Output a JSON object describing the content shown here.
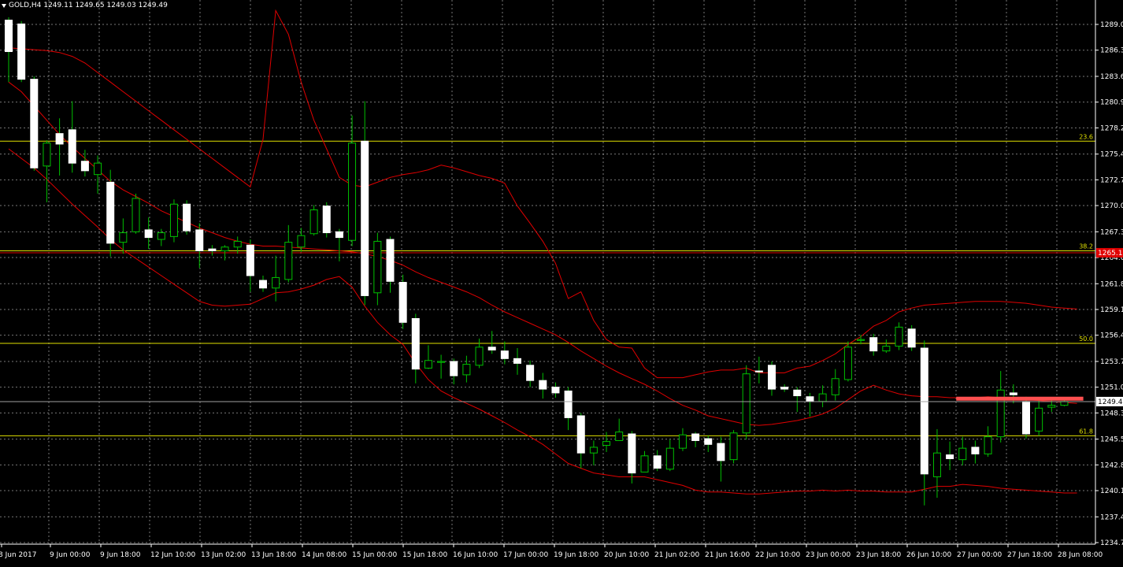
{
  "header": {
    "symbol": "GOLD,H4",
    "ohlc": "1249.11 1249.65 1249.03 1249.49"
  },
  "colors": {
    "background": "#000000",
    "grid": "#c8c8c8",
    "bull_body": "#000000",
    "bear_body": "#ffffff",
    "wick": "#00c000",
    "bollinger": "#e00000",
    "fib": "#e0e000",
    "resistance": "#ff5050",
    "price_line": "#a0a0a0"
  },
  "price_axis_labels": [
    "1289.05",
    "1286.35",
    "1283.60",
    "1280.90",
    "1278.20",
    "1275.45",
    "1272.75",
    "1270.05",
    "1267.30",
    "1264.60",
    "1261.85",
    "1259.15",
    "1256.45",
    "1253.70",
    "1251.00",
    "1248.30",
    "1245.55",
    "1242.85",
    "1240.15",
    "1237.40",
    "1234.70"
  ],
  "time_axis_labels": [
    "8 Jun 2017",
    "9 Jun 00:00",
    "9 Jun 18:00",
    "12 Jun 10:00",
    "13 Jun 02:00",
    "13 Jun 18:00",
    "14 Jun 08:00",
    "15 Jun 00:00",
    "15 Jun 18:00",
    "16 Jun 10:00",
    "17 Jun 00:00",
    "19 Jun 18:00",
    "20 Jun 10:00",
    "21 Jun 02:00",
    "21 Jun 16:00",
    "22 Jun 10:00",
    "23 Jun 00:00",
    "23 Jun 18:00",
    "26 Jun 10:00",
    "27 Jun 00:00",
    "27 Jun 18:00",
    "28 Jun 08:00"
  ],
  "current_price": {
    "label": "1249.49",
    "value": 1249.49
  },
  "red_marker": {
    "label": "1265.1",
    "value": 1265.1
  },
  "fib_levels": [
    {
      "label": "23.6",
      "value": 1276.8
    },
    {
      "label": "38.2",
      "value": 1265.3
    },
    {
      "label": "50.0",
      "value": 1255.6
    },
    {
      "label": "61.8",
      "value": 1245.9
    }
  ],
  "resistance_line": {
    "value": 1249.8,
    "from_index": 75,
    "to_index": 84
  },
  "chart_data": {
    "type": "candlestick",
    "instrument": "GOLD",
    "timeframe": "H4",
    "ylim": [
      1234.7,
      1290.5
    ],
    "candles": [
      [
        1289.5,
        1286.2,
        1289.8,
        1283.0
      ],
      [
        1289.1,
        1283.3,
        1289.4,
        1283.0
      ],
      [
        1283.3,
        1274.0,
        1283.6,
        1273.7
      ],
      [
        1274.2,
        1276.6,
        1276.9,
        1270.4
      ],
      [
        1277.6,
        1276.5,
        1279.2,
        1273.2
      ],
      [
        1278.0,
        1274.5,
        1281.0,
        1273.5
      ],
      [
        1274.7,
        1273.7,
        1275.9,
        1273.1
      ],
      [
        1273.3,
        1274.5,
        1275.3,
        1271.3
      ],
      [
        1272.5,
        1266.1,
        1273.8,
        1264.7
      ],
      [
        1266.2,
        1267.2,
        1268.7,
        1265.0
      ],
      [
        1267.3,
        1270.8,
        1271.3,
        1267.1
      ],
      [
        1267.5,
        1266.7,
        1268.8,
        1265.5
      ],
      [
        1266.5,
        1267.2,
        1267.6,
        1265.8
      ],
      [
        1266.8,
        1270.2,
        1270.7,
        1266.2
      ],
      [
        1270.2,
        1267.4,
        1270.6,
        1267.0
      ],
      [
        1267.5,
        1265.3,
        1268.2,
        1263.5
      ],
      [
        1265.5,
        1265.3,
        1265.9,
        1264.8
      ],
      [
        1265.3,
        1265.7,
        1265.9,
        1264.3
      ],
      [
        1265.7,
        1266.3,
        1266.8,
        1265.0
      ],
      [
        1265.9,
        1262.7,
        1266.5,
        1261.0
      ],
      [
        1262.2,
        1261.4,
        1262.7,
        1261.0
      ],
      [
        1261.4,
        1262.5,
        1264.8,
        1260.0
      ],
      [
        1262.3,
        1266.2,
        1268.0,
        1262.0
      ],
      [
        1265.7,
        1266.9,
        1267.7,
        1265.2
      ],
      [
        1267.1,
        1269.6,
        1270.1,
        1266.9
      ],
      [
        1270.0,
        1267.2,
        1270.4,
        1266.7
      ],
      [
        1267.3,
        1266.7,
        1267.6,
        1264.2
      ],
      [
        1266.4,
        1276.6,
        1279.5,
        1265.8
      ],
      [
        1276.8,
        1260.6,
        1281.0,
        1259.6
      ],
      [
        1260.9,
        1266.3,
        1267.2,
        1259.6
      ],
      [
        1266.5,
        1262.1,
        1266.8,
        1260.9
      ],
      [
        1262.0,
        1257.8,
        1262.8,
        1257.1
      ],
      [
        1258.2,
        1252.9,
        1258.7,
        1251.4
      ],
      [
        1253.0,
        1253.8,
        1255.4,
        1252.9
      ],
      [
        1253.6,
        1253.7,
        1254.4,
        1251.9
      ],
      [
        1253.7,
        1252.2,
        1254.0,
        1251.3
      ],
      [
        1252.3,
        1253.4,
        1254.3,
        1251.5
      ],
      [
        1253.3,
        1255.2,
        1256.1,
        1253.0
      ],
      [
        1255.2,
        1254.9,
        1256.9,
        1254.5
      ],
      [
        1254.8,
        1254.0,
        1255.8,
        1253.4
      ],
      [
        1254.0,
        1253.5,
        1255.1,
        1252.3
      ],
      [
        1253.3,
        1251.7,
        1253.8,
        1251.0
      ],
      [
        1251.7,
        1250.8,
        1252.5,
        1249.8
      ],
      [
        1251.0,
        1250.4,
        1251.5,
        1249.9
      ],
      [
        1250.6,
        1247.8,
        1251.0,
        1246.5
      ],
      [
        1248.0,
        1244.1,
        1248.3,
        1242.5
      ],
      [
        1244.1,
        1244.7,
        1245.4,
        1242.8
      ],
      [
        1244.9,
        1245.3,
        1246.3,
        1244.2
      ],
      [
        1245.4,
        1246.3,
        1247.7,
        1245.6
      ],
      [
        1246.1,
        1242.0,
        1246.4,
        1240.9
      ],
      [
        1242.1,
        1243.8,
        1244.3,
        1242.9
      ],
      [
        1243.8,
        1242.5,
        1244.4,
        1242.2
      ],
      [
        1242.4,
        1244.6,
        1245.5,
        1242.2
      ],
      [
        1244.6,
        1246.0,
        1246.7,
        1244.3
      ],
      [
        1246.1,
        1245.4,
        1246.3,
        1244.7
      ],
      [
        1245.6,
        1245.0,
        1245.9,
        1244.2
      ],
      [
        1245.1,
        1243.3,
        1245.8,
        1241.1
      ],
      [
        1243.4,
        1246.2,
        1246.5,
        1243.0
      ],
      [
        1246.2,
        1252.4,
        1253.3,
        1245.5
      ],
      [
        1252.7,
        1252.6,
        1254.2,
        1251.4
      ],
      [
        1253.3,
        1250.8,
        1253.7,
        1250.1
      ],
      [
        1251.0,
        1250.8,
        1251.3,
        1250.5
      ],
      [
        1250.7,
        1250.1,
        1251.0,
        1248.4
      ],
      [
        1250.0,
        1249.5,
        1250.4,
        1247.9
      ],
      [
        1249.5,
        1250.3,
        1251.2,
        1248.9
      ],
      [
        1250.2,
        1251.9,
        1252.9,
        1249.6
      ],
      [
        1251.8,
        1255.2,
        1255.8,
        1251.6
      ],
      [
        1255.9,
        1256.0,
        1256.5,
        1255.5
      ],
      [
        1256.2,
        1254.8,
        1256.6,
        1254.3
      ],
      [
        1254.8,
        1255.3,
        1256.0,
        1254.6
      ],
      [
        1255.3,
        1257.3,
        1257.8,
        1254.9
      ],
      [
        1257.1,
        1255.2,
        1257.5,
        1254.8
      ],
      [
        1255.1,
        1241.9,
        1255.9,
        1238.6
      ],
      [
        1241.6,
        1244.1,
        1246.6,
        1239.4
      ],
      [
        1243.9,
        1243.5,
        1245.3,
        1242.3
      ],
      [
        1243.4,
        1244.6,
        1245.8,
        1242.8
      ],
      [
        1244.7,
        1244.0,
        1245.4,
        1243.0
      ],
      [
        1244.0,
        1245.8,
        1246.9,
        1243.7
      ],
      [
        1245.8,
        1250.7,
        1252.7,
        1245.2
      ],
      [
        1250.4,
        1250.2,
        1251.3,
        1249.3
      ],
      [
        1249.5,
        1246.1,
        1250.0,
        1245.6
      ],
      [
        1246.4,
        1248.8,
        1249.6,
        1245.9
      ],
      [
        1248.9,
        1249.1,
        1249.9,
        1248.4
      ],
      [
        1249.1,
        1249.5,
        1249.7,
        1249.0
      ]
    ],
    "bollinger_upper": [
      1286.6,
      1286.5,
      1286.4,
      1286.3,
      1286.1,
      1285.7,
      1285.0,
      1284.0,
      1283.0,
      1282.0,
      1281.0,
      1280.0,
      1279.0,
      1278.0,
      1277.0,
      1276.0,
      1275.0,
      1274.0,
      1273.0,
      1272.0,
      1277.0,
      1290.5,
      1288.0,
      1283.0,
      1279.0,
      1276.0,
      1273.0,
      1272.2,
      1272.0,
      1272.5,
      1273.0,
      1273.3,
      1273.5,
      1273.8,
      1274.3,
      1274.0,
      1273.6,
      1273.2,
      1272.9,
      1272.4,
      1270.0,
      1268.2,
      1266.3,
      1264.0,
      1260.3,
      1261.0,
      1258.0,
      1256.0,
      1255.2,
      1255.1,
      1253.0,
      1252.0,
      1252.0,
      1252.0,
      1252.3,
      1252.6,
      1252.8,
      1252.8,
      1253.0,
      1252.5,
      1252.5,
      1252.5,
      1253.0,
      1253.2,
      1253.8,
      1254.5,
      1255.5,
      1256.3,
      1257.4,
      1258.0,
      1258.9,
      1259.3,
      1259.6,
      1259.7,
      1259.8,
      1259.9,
      1260.0,
      1260.0,
      1260.0,
      1259.9,
      1259.8,
      1259.6,
      1259.4,
      1259.3,
      1259.2
    ],
    "bollinger_middle": [
      1283.0,
      1282.0,
      1280.5,
      1279.0,
      1277.5,
      1276.2,
      1275.0,
      1273.8,
      1272.6,
      1271.7,
      1271.0,
      1270.3,
      1269.5,
      1268.9,
      1268.3,
      1267.7,
      1267.2,
      1266.7,
      1266.3,
      1266.0,
      1265.8,
      1265.8,
      1265.7,
      1265.6,
      1265.5,
      1265.4,
      1265.3,
      1265.2,
      1265.0,
      1264.7,
      1264.3,
      1263.8,
      1263.1,
      1262.5,
      1262.0,
      1261.5,
      1261.0,
      1260.4,
      1259.6,
      1258.9,
      1258.3,
      1257.7,
      1257.1,
      1256.5,
      1255.7,
      1254.8,
      1254.0,
      1253.2,
      1252.5,
      1251.9,
      1251.3,
      1250.6,
      1249.8,
      1249.1,
      1248.6,
      1248.0,
      1247.7,
      1247.4,
      1247.1,
      1247.0,
      1247.1,
      1247.3,
      1247.5,
      1247.8,
      1248.2,
      1248.8,
      1249.7,
      1250.6,
      1251.2,
      1250.7,
      1250.3,
      1250.1,
      1250.0,
      1250.0,
      1249.9,
      1249.9,
      1249.9,
      1250.0,
      1249.9,
      1249.8,
      1249.7,
      1249.6,
      1249.5,
      1249.4,
      1249.3
    ],
    "bollinger_lower": [
      1276.0,
      1275.0,
      1274.0,
      1272.8,
      1271.5,
      1270.2,
      1269.0,
      1267.8,
      1266.5,
      1265.4,
      1264.5,
      1263.6,
      1262.7,
      1261.8,
      1260.9,
      1260.0,
      1259.6,
      1259.5,
      1259.6,
      1259.7,
      1260.3,
      1260.9,
      1261.0,
      1261.3,
      1261.7,
      1262.3,
      1262.6,
      1261.5,
      1259.5,
      1257.8,
      1256.5,
      1255.5,
      1253.5,
      1251.8,
      1250.6,
      1249.9,
      1249.3,
      1248.7,
      1248.0,
      1247.3,
      1246.5,
      1245.8,
      1245.0,
      1244.0,
      1243.0,
      1242.5,
      1242.0,
      1241.8,
      1241.6,
      1241.6,
      1241.6,
      1241.3,
      1241.0,
      1240.7,
      1240.2,
      1240.0,
      1240.0,
      1239.9,
      1239.8,
      1239.8,
      1239.9,
      1240.0,
      1240.1,
      1240.1,
      1240.2,
      1240.1,
      1240.2,
      1240.1,
      1240.1,
      1240.0,
      1240.0,
      1240.0,
      1240.3,
      1240.6,
      1240.6,
      1240.8,
      1240.7,
      1240.6,
      1240.4,
      1240.3,
      1240.2,
      1240.1,
      1240.0,
      1239.9,
      1239.9
    ]
  }
}
